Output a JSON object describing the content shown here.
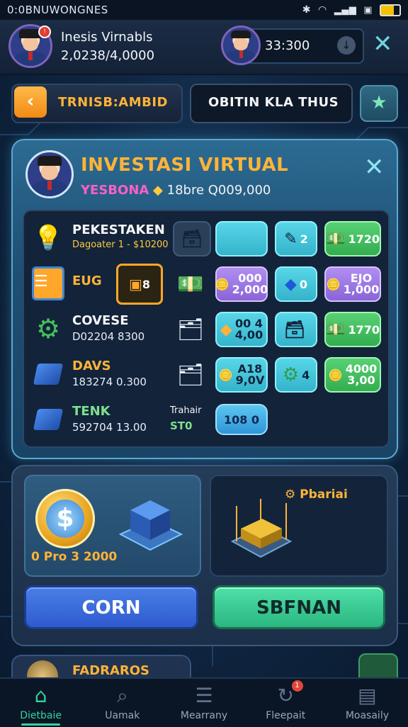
{
  "status_bar": {
    "left_text": "0:0BNUWONGNES"
  },
  "profile": {
    "name": "Inesis Virnabls",
    "balance": "2,0238/4,0000"
  },
  "coins": {
    "value": "33:300"
  },
  "tabs": {
    "back_label": "TRNISB:AMBID",
    "secondary_label": "OBITIN KLA THUS"
  },
  "panel": {
    "title": "INVESTASI VIRTUAL",
    "sub_tag": "YESBONA",
    "sub_value": "18bre Q009,000"
  },
  "rows": [
    {
      "name": "PEKESTAKEN",
      "sub": "Dagoater 1 - $10200",
      "icon": "lightbulb-icon",
      "tiles": [
        {
          "text": "2",
          "color": "cyan",
          "icon": "wire-icon"
        },
        {
          "text": "1720",
          "color": "green",
          "icon": "cash-icon"
        }
      ]
    },
    {
      "name": "EUG",
      "sub": "",
      "icon": "ledger-icon",
      "box_text": "8",
      "tiles": [
        {
          "line1": "000",
          "line2": "2,000",
          "color": "purple"
        },
        {
          "text": "0",
          "color": "cyan",
          "icon": "chip-icon"
        },
        {
          "line1": "EJO",
          "line2": "1,000",
          "color": "purple"
        }
      ]
    },
    {
      "name": "COVESE",
      "sub": "D02204 8300",
      "icon": "gear-icon",
      "tiles": [
        {
          "line1": "00 4",
          "line2": "4,00",
          "color": "cyan"
        },
        {
          "text": "",
          "color": "cyan",
          "icon": "cash-stack-icon"
        },
        {
          "text": "1770",
          "color": "green",
          "icon": "cash-icon"
        }
      ]
    },
    {
      "name": "DAVS",
      "sub": "183274 0.300",
      "icon": "cube-icon",
      "tiles": [
        {
          "line1": "A18",
          "line2": "9,0V",
          "color": "cyan"
        },
        {
          "text": "4",
          "color": "green",
          "icon": "gear-icon"
        },
        {
          "line1": "4000",
          "line2": "3,00",
          "color": "green"
        }
      ]
    },
    {
      "name": "TENK",
      "sub": "592704 13.00",
      "icon": "cube-icon",
      "mid_label": "Trahair",
      "mid_sub": "ST0",
      "tiles": [
        {
          "text": "108 0",
          "color": "blue"
        }
      ]
    }
  ],
  "shop": {
    "coin_price": "0 Pro 3 2000",
    "tower_label": "Pbariai"
  },
  "buttons": {
    "left": "CORN",
    "right": "SBFNAN"
  },
  "peek": {
    "label": "FADRAROS"
  },
  "nav": [
    {
      "label": "Dietbaie",
      "icon": "home-icon",
      "active": true
    },
    {
      "label": "Uamak",
      "icon": "search-icon",
      "active": false
    },
    {
      "label": "Mearrany",
      "icon": "document-icon",
      "active": false
    },
    {
      "label": "Fleepait",
      "icon": "refresh-icon",
      "active": false,
      "badge": "1"
    },
    {
      "label": "Moasaily",
      "icon": "briefcase-icon",
      "active": false
    }
  ],
  "colors": {
    "accent_gold": "#ffb338",
    "accent_green": "#35d39a",
    "panel_border": "#5aa9d0"
  }
}
